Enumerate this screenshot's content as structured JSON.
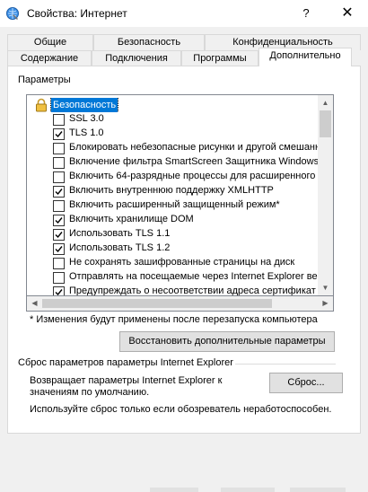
{
  "window": {
    "title": "Свойства: Интернет",
    "help_glyph": "?",
    "close_glyph": "✕"
  },
  "tabs_row1": [
    {
      "label": "Общие"
    },
    {
      "label": "Безопасность"
    },
    {
      "label": "Конфиденциальность"
    }
  ],
  "tabs_row2": [
    {
      "label": "Содержание"
    },
    {
      "label": "Подключения"
    },
    {
      "label": "Программы"
    },
    {
      "label": "Дополнительно"
    }
  ],
  "settings": {
    "group_label": "Параметры",
    "header_item": "Безопасность",
    "items": [
      {
        "label": "SSL 3.0",
        "checked": false
      },
      {
        "label": "TLS 1.0",
        "checked": true
      },
      {
        "label": "Блокировать небезопасные рисунки и другой смешанн",
        "checked": false
      },
      {
        "label": "Включение фильтра SmartScreen Защитника Windows",
        "checked": false
      },
      {
        "label": "Включить 64-разрядные процессы для расширенного",
        "checked": false
      },
      {
        "label": "Включить внутреннюю поддержку XMLHTTP",
        "checked": true
      },
      {
        "label": "Включить расширенный защищенный режим*",
        "checked": false
      },
      {
        "label": "Включить хранилище DOM",
        "checked": true
      },
      {
        "label": "Использовать TLS 1.1",
        "checked": true
      },
      {
        "label": "Использовать TLS 1.2",
        "checked": true
      },
      {
        "label": "Не сохранять зашифрованные страницы на диск",
        "checked": false
      },
      {
        "label": "Отправлять на посещаемые через Internet Explorer ве",
        "checked": false
      },
      {
        "label": "Предупреждать о несоответствии адреса сертификат",
        "checked": true
      }
    ],
    "restart_note": "* Изменения будут применены после перезапуска компьютера",
    "restore_button": "Восстановить дополнительные параметры"
  },
  "reset": {
    "group_label": "Сброс параметров параметры Internet Explorer",
    "description": "Возвращает параметры Internet Explorer к значениям по умолчанию.",
    "button": "Сброс...",
    "warning": "Используйте сброс только если обозреватель неработоспособен."
  },
  "colors": {
    "selection": "#0078d7",
    "window_bg": "#f0f0f0"
  }
}
